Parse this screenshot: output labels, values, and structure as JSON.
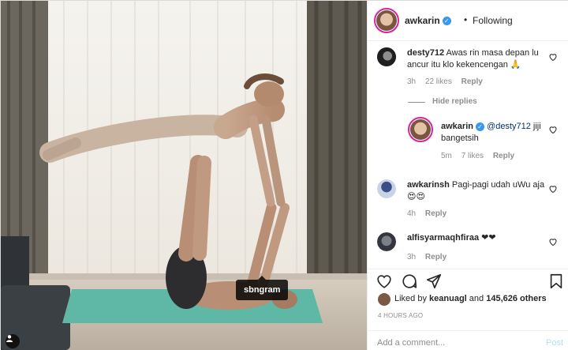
{
  "photo": {
    "tag_label": "sbngram",
    "icon": "user-tag-icon"
  },
  "header": {
    "username": "awkarin",
    "verified_icon": "verified-badge-icon",
    "dot": "•",
    "follow_status": "Following"
  },
  "comments": [
    {
      "username": "desty712",
      "text": "Awas rin masa depan lu ancur itu klo kekencengan 🙏",
      "age": "3h",
      "likes": "22 likes",
      "reply": "Reply"
    },
    {
      "hide_replies": "Hide replies"
    },
    {
      "username": "awkarin",
      "mention": "@desty712",
      "text": "jiji bangetsih",
      "age": "5m",
      "likes": "7 likes",
      "reply": "Reply"
    },
    {
      "username": "awkarinsh",
      "text": "Pagi-pagi udah uWu aja 😍😍",
      "age": "4h",
      "reply": "Reply"
    },
    {
      "username": "alfisyarmaqhfiraa",
      "text": "❤❤",
      "age": "3h",
      "reply": "Reply"
    }
  ],
  "actions": {
    "like_icon": "heart-icon",
    "comment_icon": "comment-icon",
    "share_icon": "share-icon",
    "save_icon": "bookmark-icon"
  },
  "likes": {
    "prefix": "Liked by",
    "user": "keanuagl",
    "and": "and",
    "count": "145,626 others"
  },
  "timestamp": "4 HOURS AGO",
  "add_comment": {
    "placeholder": "Add a comment...",
    "post_label": "Post"
  },
  "colors": {
    "mat": "#5fb8a6",
    "curtain_dark": "#585449",
    "window_light": "#f3f1ec",
    "link": "#003569",
    "post_disabled": "#b2dffc",
    "verified": "#3897f0"
  }
}
